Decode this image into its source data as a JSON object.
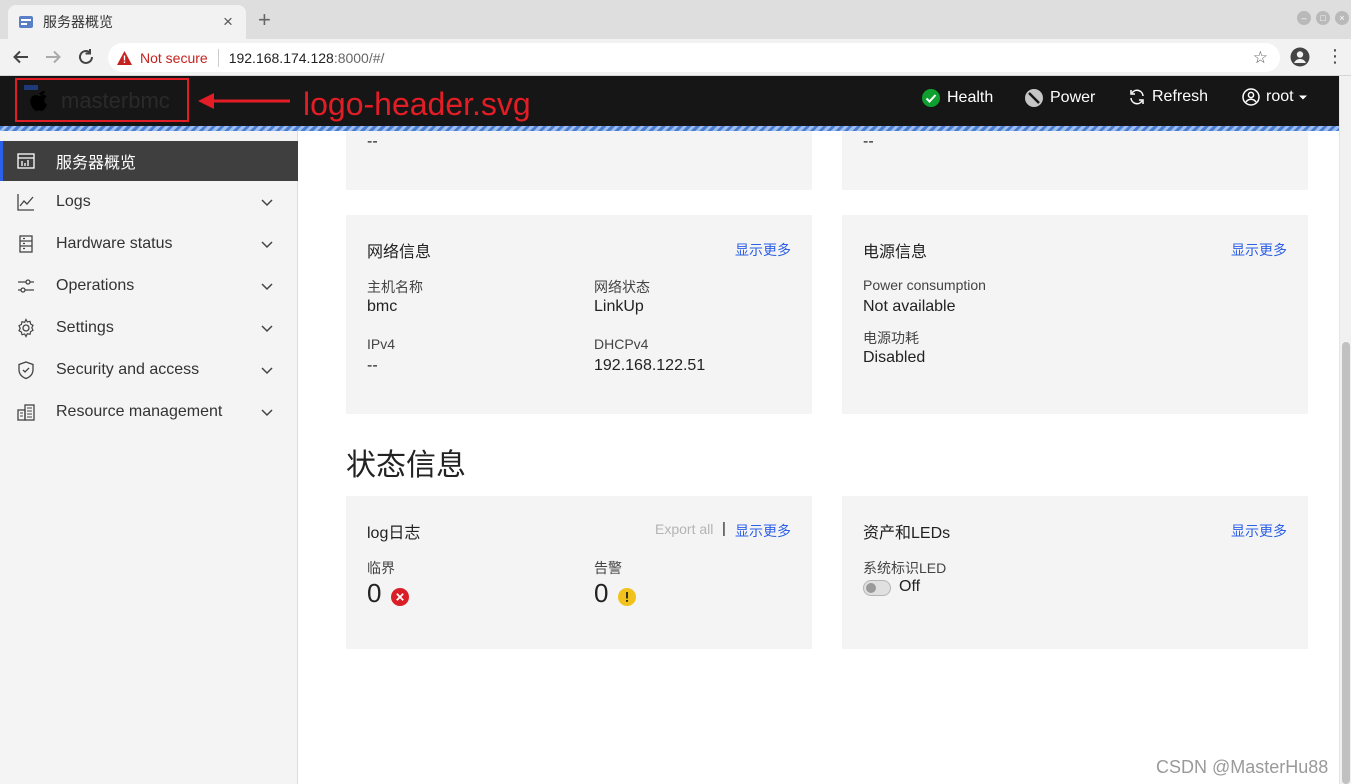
{
  "browser": {
    "tab_title": "服务器概览",
    "security_label": "Not secure",
    "url_host": "192.168.174.128",
    "url_rest": ":8000/#/"
  },
  "header": {
    "brand": "masterbmc",
    "annotation": "logo-header.svg",
    "health": "Health",
    "power": "Power",
    "refresh": "Refresh",
    "user": "root"
  },
  "sidebar": {
    "items": [
      {
        "label": "服务器概览",
        "icon": "dashboard-icon"
      },
      {
        "label": "Logs",
        "icon": "chart-icon"
      },
      {
        "label": "Hardware status",
        "icon": "server-icon"
      },
      {
        "label": "Operations",
        "icon": "sliders-icon"
      },
      {
        "label": "Settings",
        "icon": "gear-icon"
      },
      {
        "label": "Security and access",
        "icon": "shield-icon"
      },
      {
        "label": "Resource management",
        "icon": "building-icon"
      }
    ]
  },
  "top_cards": {
    "left_value": "--",
    "right_value": "--"
  },
  "network": {
    "title": "网络信息",
    "more": "显示更多",
    "hostname_label": "主机名称",
    "hostname": "bmc",
    "status_label": "网络状态",
    "status": "LinkUp",
    "ipv4_label": "IPv4",
    "ipv4": "--",
    "dhcp_label": "DHCPv4",
    "dhcp": "192.168.122.51"
  },
  "power": {
    "title": "电源信息",
    "more": "显示更多",
    "consumption_label": "Power consumption",
    "consumption": "Not available",
    "cap_label": "电源功耗",
    "cap": "Disabled"
  },
  "status_section": {
    "title": "状态信息"
  },
  "log": {
    "title": "log日志",
    "export": "Export all",
    "divider": "|",
    "more": "显示更多",
    "critical_label": "临界",
    "critical": "0",
    "warning_label": "告警",
    "warning": "0"
  },
  "assets": {
    "title": "资产和LEDs",
    "more": "显示更多",
    "led_label": "系统标识LED",
    "led_state": "Off"
  },
  "watermark": "CSDN @MasterHu88",
  "colors": {
    "accent": "#2d60e8",
    "header_bg": "#161616",
    "annotation": "#e21d25",
    "ok": "#0e9f2f",
    "error": "#da1e28",
    "warning": "#f1c21b"
  }
}
